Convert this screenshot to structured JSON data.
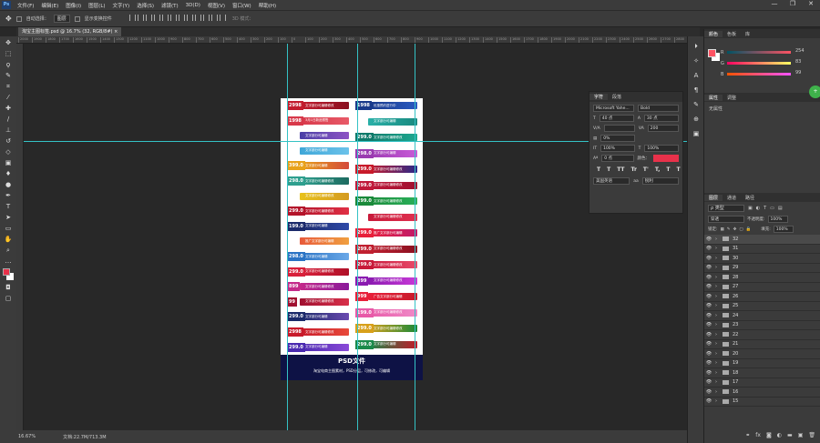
{
  "app": {
    "logo": "Ps"
  },
  "menu": [
    "文件(F)",
    "编辑(E)",
    "图像(I)",
    "图层(L)",
    "文字(Y)",
    "选择(S)",
    "滤镜(T)",
    "3D(D)",
    "视图(V)",
    "窗口(W)",
    "帮助(H)"
  ],
  "window_controls": [
    "—",
    "❐",
    "✕"
  ],
  "options": {
    "auto_select_label": "自动选择：",
    "auto_select_value": "图层",
    "show_transform_label": "显示变换控件",
    "mode_3d": "3D 模式："
  },
  "tab": {
    "label": "淘宝主图标签.psd @ 16.7% (32, RGB/8#)",
    "close": "×"
  },
  "status": {
    "zoom": "16.67%",
    "doc": "文档:22.7M/713.3M"
  },
  "ruler_marks": [
    "2000",
    "1900",
    "1800",
    "1700",
    "1600",
    "1500",
    "1400",
    "1300",
    "1200",
    "1100",
    "1000",
    "900",
    "800",
    "700",
    "600",
    "500",
    "400",
    "300",
    "200",
    "100",
    "0",
    "100",
    "200",
    "300",
    "400",
    "500",
    "600",
    "700",
    "800",
    "900",
    "1000",
    "1100",
    "1200",
    "1300",
    "1400",
    "1500",
    "1600",
    "1700",
    "1800",
    "1900",
    "2000",
    "2100",
    "2200",
    "2300",
    "2400",
    "2500",
    "2600",
    "2700",
    "2800",
    "2900",
    "3000"
  ],
  "document": {
    "footer_title": "PSD文件",
    "footer_sub": "淘宝电商主图素材，PSD分层，可修改，可编辑",
    "left_tags": [
      {
        "price": "2998",
        "label": "文字部分可编辑修改",
        "c1": "#c31d2e",
        "c2": "#8a1020"
      },
      {
        "price": "1998",
        "label": "3月1日新品预售",
        "c1": "#d8394a",
        "c2": "#e85a68"
      },
      {
        "price": "",
        "label": "文字部分可编辑",
        "c1": "#4a3fa6",
        "c2": "#8c53c4"
      },
      {
        "price": "",
        "label": "文字部分可编辑",
        "c1": "#3fa7d8",
        "c2": "#6bc2ea"
      },
      {
        "price": "399.0",
        "label": "文字部分可编辑",
        "c1": "#e8a21a",
        "c2": "#d44a3a"
      },
      {
        "price": "298.0",
        "label": "文字部分可编辑修改",
        "c1": "#2e9f8e",
        "c2": "#1e6b60"
      },
      {
        "price": "",
        "label": "文字部分可编辑修改",
        "c1": "#e8c21a",
        "c2": "#d49a20"
      },
      {
        "price": "299.0",
        "label": "文字部分可编辑修改",
        "c1": "#b4142a",
        "c2": "#e03045"
      },
      {
        "price": "199.0",
        "label": "文字部分可编辑",
        "c1": "#1b2a6b",
        "c2": "#2f4aa8"
      },
      {
        "price": "",
        "label": "推广文字部分可编辑",
        "c1": "#e85a3a",
        "c2": "#f0a040"
      },
      {
        "price": "298.0",
        "label": "文字部分可编辑",
        "c1": "#2a73c4",
        "c2": "#6aa8e8"
      },
      {
        "price": "299.0",
        "label": "文字部分可编辑修改",
        "c1": "#d8203a",
        "c2": "#b01028"
      },
      {
        "price": "899",
        "label": "文字部分可编辑修改",
        "c1": "#c42a8a",
        "c2": "#8a1a9a"
      },
      {
        "price": "99",
        "label": "文字部分可编辑修改",
        "c1": "#a01030",
        "c2": "#d8304a"
      },
      {
        "price": "299.0",
        "label": "文字部分可编辑",
        "c1": "#1a2a6a",
        "c2": "#6a4ab0"
      },
      {
        "price": "2998",
        "label": "文字部分可编辑修改",
        "c1": "#c81a2a",
        "c2": "#e84a3a"
      },
      {
        "price": "299.0",
        "label": "文字部分可编辑",
        "c1": "#4a2ab0",
        "c2": "#8a4ad8"
      }
    ],
    "right_tags": [
      {
        "price": "1998",
        "label": "优惠预约进行中",
        "c1": "#1a3a8a",
        "c2": "#2a5ac0"
      },
      {
        "price": "",
        "label": "文字部分可编辑",
        "c1": "#2ab0a8",
        "c2": "#1a8a80"
      },
      {
        "price": "299.0",
        "label": "文字部分可编辑修改",
        "c1": "#0e7a6a",
        "c2": "#1ea890"
      },
      {
        "price": "298.0",
        "label": "文字部分可编辑",
        "c1": "#9a3ab0",
        "c2": "#c85ad8"
      },
      {
        "price": "299.0",
        "label": "文字部分可编辑修改",
        "c1": "#c81a2a",
        "c2": "#2a2a8a"
      },
      {
        "price": "299.0",
        "label": "文字部分可编辑修改",
        "c1": "#c01a3a",
        "c2": "#a01030"
      },
      {
        "price": "299.0",
        "label": "文字部分可编辑修改",
        "c1": "#1a8a3a",
        "c2": "#2ab05a"
      },
      {
        "price": "",
        "label": "文字部分可编辑修改",
        "c1": "#c81a3a",
        "c2": "#e03050"
      },
      {
        "price": "299.0",
        "label": "推广文字部分可编辑",
        "c1": "#e8203a",
        "c2": "#c01a6a"
      },
      {
        "price": "299.0",
        "label": "文字部分可编辑修改",
        "c1": "#c02030",
        "c2": "#8a1020"
      },
      {
        "price": "299.0",
        "label": "文字部分可编辑修改",
        "c1": "#c81a3a",
        "c2": "#e84a6a"
      },
      {
        "price": "899",
        "label": "文字部分可编辑修改",
        "c1": "#8a1ab0",
        "c2": "#c83ad8"
      },
      {
        "price": "999",
        "label": "广告文字部分可编辑",
        "c1": "#e8203a",
        "c2": "#c81a2a"
      },
      {
        "price": "199.0",
        "label": "文字部分可编辑修改",
        "c1": "#e85aa8",
        "c2": "#f08ac8"
      },
      {
        "price": "299.0",
        "label": "文字部分可编辑修改",
        "c1": "#d8a01a",
        "c2": "#1a8a3a"
      },
      {
        "price": "299.0",
        "label": "文字部分可编辑",
        "c1": "#1a8a4a",
        "c2": "#c01a2a"
      }
    ]
  },
  "char_panel": {
    "tabs": [
      "字符",
      "段落"
    ],
    "font": "Microsoft Yahe...",
    "style": "Bold",
    "size": "40 点",
    "leading": "30 点",
    "kerning": "",
    "tracking": "200",
    "scale_pct": "0%",
    "vscale": "100%",
    "hscale": "100%",
    "baseline": "0 点",
    "color_label": "颜色：",
    "color": "#e8314a",
    "tt_buttons": [
      "T",
      "T",
      "TT",
      "Tr",
      "T'",
      "T,",
      "T",
      "T"
    ],
    "language": "美国英语",
    "aa": "aa",
    "aa_value": "锐利"
  },
  "color_panel": {
    "tabs": [
      "颜色",
      "色板",
      "库"
    ],
    "r": "254",
    "g": "83",
    "b": "99",
    "fg": "#fe5363",
    "bg": "#ffffff"
  },
  "props_panel": {
    "tabs": [
      "属性",
      "调整"
    ],
    "body": "无属性"
  },
  "layers_panel": {
    "tabs": [
      "图层",
      "通道",
      "路径"
    ],
    "kind": "ρ 类型",
    "blend": "穿透",
    "opacity_label": "不透明度:",
    "opacity": "100%",
    "lock_label": "锁定:",
    "fill_label": "填充:",
    "fill": "100%",
    "layers": [
      "32",
      "31",
      "30",
      "29",
      "28",
      "27",
      "26",
      "25",
      "24",
      "23",
      "22",
      "21",
      "20",
      "19",
      "18",
      "17",
      "16",
      "15"
    ]
  },
  "side_badge": "+"
}
